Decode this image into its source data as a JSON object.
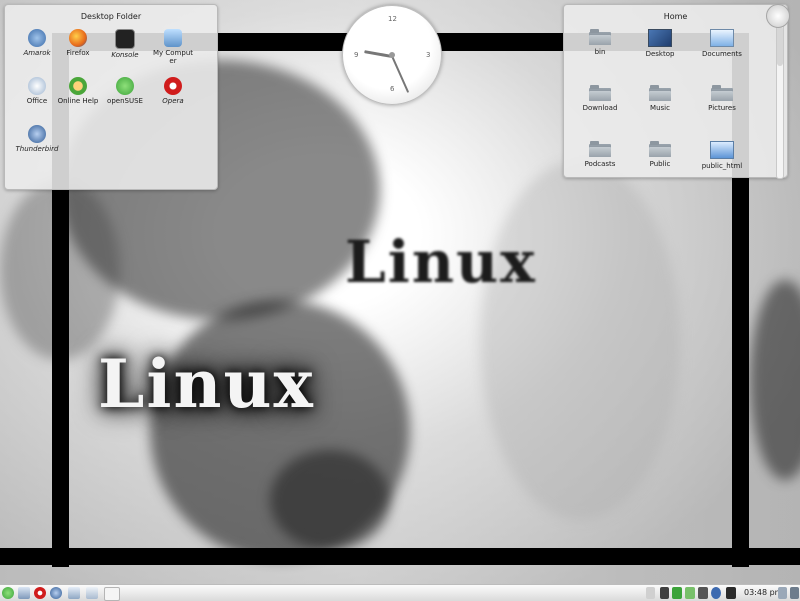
{
  "desktop_folder": {
    "title": "Desktop Folder",
    "icons": [
      {
        "label": "Amarok",
        "icon": "amarok-icon",
        "color": "#3a6aa8"
      },
      {
        "label": "Firefox",
        "icon": "firefox-icon",
        "color": "#e86a1a"
      },
      {
        "label": "Konsole",
        "icon": "konsole-icon",
        "color": "#222222"
      },
      {
        "label": "My Computer",
        "icon": "computer-icon",
        "color": "#5f93c9"
      },
      {
        "label": "Office",
        "icon": "office-icon",
        "color": "#9bb3cf"
      },
      {
        "label": "Online Help",
        "icon": "help-icon",
        "color": "#4aa63a"
      },
      {
        "label": "openSUSE",
        "icon": "opensuse-icon",
        "color": "#3ca33a"
      },
      {
        "label": "Opera",
        "icon": "opera-icon",
        "color": "#d01c1c"
      },
      {
        "label": "Thunderbird",
        "icon": "thunderbird-icon",
        "color": "#2e5a94"
      }
    ]
  },
  "home": {
    "title": "Home",
    "items": [
      {
        "label": "bin",
        "icon": "folder-icon"
      },
      {
        "label": "Desktop",
        "icon": "desktop-folder-icon"
      },
      {
        "label": "Documents",
        "icon": "documents-folder-icon"
      },
      {
        "label": "Download",
        "icon": "folder-icon"
      },
      {
        "label": "Music",
        "icon": "folder-icon"
      },
      {
        "label": "Pictures",
        "icon": "folder-icon"
      },
      {
        "label": "Podcasts",
        "icon": "folder-icon"
      },
      {
        "label": "Public",
        "icon": "folder-icon"
      },
      {
        "label": "public_html",
        "icon": "public-html-folder-icon"
      }
    ]
  },
  "clock_widget": {
    "numbers": [
      "12",
      "3",
      "6",
      "9"
    ]
  },
  "wallpaper": {
    "text_small": "Linux",
    "text_big": "Linux"
  },
  "taskbar": {
    "time": "03:48 pm",
    "left_icons": [
      "opensuse-launcher-icon",
      "file-manager-icon",
      "opera-icon",
      "thunderbird-icon",
      "desktop-icon",
      "pager-icon",
      "pager-icon"
    ],
    "tray_icons": [
      "clipboard-icon",
      "monitor-icon",
      "network-icon",
      "package-updater-icon",
      "printer-icon",
      "volume-icon",
      "kde-info-icon",
      "wifi-icon"
    ]
  },
  "colors": {
    "accent": "#3ca33a",
    "folder": "#8d97a0"
  }
}
